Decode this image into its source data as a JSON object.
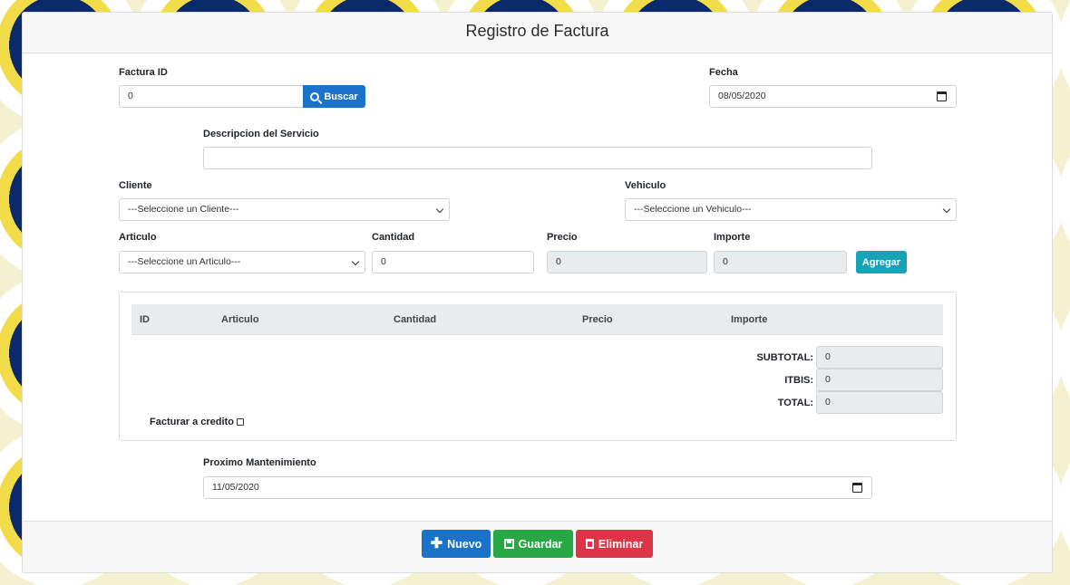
{
  "header": {
    "title": "Registro de Factura"
  },
  "factura": {
    "label": "Factura ID",
    "value": "0",
    "search_label": "Buscar"
  },
  "fecha": {
    "label": "Fecha",
    "value": "08/05/2020"
  },
  "descripcion": {
    "label": "Descripcion del Servicio",
    "value": ""
  },
  "cliente": {
    "label": "Cliente",
    "selected": "---Seleccione un Cliente---"
  },
  "vehiculo": {
    "label": "Vehiculo",
    "selected": "---Seleccione un Vehiculo---"
  },
  "articulo": {
    "label": "Articulo",
    "selected": "---Seleccione un Articulo---"
  },
  "cantidad": {
    "label": "Cantidad",
    "value": "0"
  },
  "precio": {
    "label": "Precio",
    "value": "0"
  },
  "importe": {
    "label": "Importe",
    "value": "0"
  },
  "agregar_label": "Agregar",
  "table": {
    "columns": [
      "ID",
      "Articulo",
      "Cantidad",
      "Precio",
      "Importe"
    ]
  },
  "totals": {
    "subtotal_label": "SUBTOTAL:",
    "subtotal": "0",
    "itbis_label": "ITBIS:",
    "itbis": "0",
    "total_label": "TOTAL:",
    "total": "0"
  },
  "credito": {
    "label": "Facturar a credito",
    "checked": false
  },
  "mantenimiento": {
    "label": "Proximo Mantenimiento",
    "value": "11/05/2020"
  },
  "buttons": {
    "nuevo": "Nuevo",
    "guardar": "Guardar",
    "eliminar": "Eliminar"
  },
  "colors": {
    "primary": "#1a73c9",
    "success": "#28a745",
    "danger": "#dc3545",
    "info": "#17a2b8"
  },
  "icons": {
    "search": "search-icon",
    "plus": "plus-icon",
    "save": "save-icon",
    "trash": "trash-icon",
    "calendar": "calendar-icon",
    "chevron": "chevron-down-icon"
  }
}
